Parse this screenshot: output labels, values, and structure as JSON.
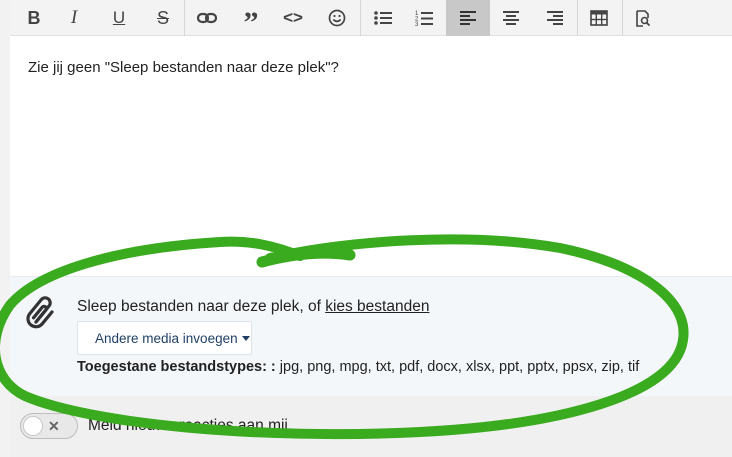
{
  "editor": {
    "content_text": "Zie jij geen \"Sleep bestanden naar deze plek\"?"
  },
  "toolbar": {
    "buttons": [
      {
        "name": "bold",
        "glyph": "B"
      },
      {
        "name": "italic",
        "glyph": "I"
      },
      {
        "name": "underline",
        "glyph": "U"
      },
      {
        "name": "strikethrough",
        "glyph": "S"
      },
      {
        "name": "link",
        "icon": "link-icon"
      },
      {
        "name": "quote",
        "glyph": "”"
      },
      {
        "name": "code",
        "glyph": "<>"
      },
      {
        "name": "emoji",
        "icon": "smiley-icon"
      },
      {
        "name": "bulleted-list",
        "icon": "bulleted-list-icon"
      },
      {
        "name": "numbered-list",
        "icon": "numbered-list-icon"
      },
      {
        "name": "align-left",
        "icon": "align-left-icon",
        "active": true
      },
      {
        "name": "align-center",
        "icon": "align-center-icon"
      },
      {
        "name": "align-right",
        "icon": "align-right-icon"
      },
      {
        "name": "table",
        "icon": "table-icon"
      },
      {
        "name": "preview",
        "icon": "preview-icon"
      }
    ]
  },
  "dropzone": {
    "prefix": "Sleep bestanden naar deze plek, of ",
    "link": "kies bestanden",
    "media_button": "Andere media invoegen",
    "types_label": "Toegestane bestandstypes: :",
    "types_value": " jpg, png, mpg, txt, pdf, docx, xlsx, ppt, pptx, ppsx, zip, tif"
  },
  "notify": {
    "label": "Meld nieuwe reacties aan mij"
  },
  "colors": {
    "annotation": "#3aaa1e",
    "media_text": "#1f3f66"
  }
}
